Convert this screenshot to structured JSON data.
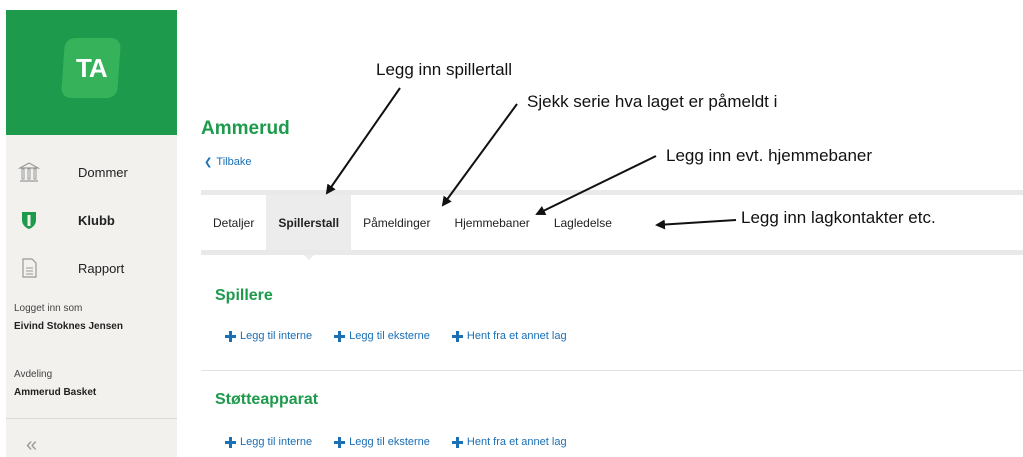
{
  "sidebar": {
    "logo_text": "TA",
    "brand_color": "#1e9a4c",
    "items": [
      {
        "label": "Dommer",
        "icon": "courthouse-icon"
      },
      {
        "label": "Klubb",
        "icon": "shield-icon"
      },
      {
        "label": "Rapport",
        "icon": "document-icon"
      }
    ],
    "logged_in_label": "Logget inn som",
    "logged_in_user": "Eivind Stoknes Jensen",
    "department_label": "Avdeling",
    "department_name": "Ammerud Basket",
    "collapse_icon": "double-chevron-left-icon"
  },
  "main": {
    "title": "Ammerud",
    "back_label": "Tilbake",
    "tabs": [
      {
        "label": "Detaljer"
      },
      {
        "label": "Spillerstall",
        "active": true
      },
      {
        "label": "Påmeldinger"
      },
      {
        "label": "Hjemmebaner"
      },
      {
        "label": "Lagledelse"
      }
    ],
    "sections": [
      {
        "title": "Spillere",
        "actions": [
          "Legg til interne",
          "Legg til eksterne",
          "Hent fra et annet lag"
        ]
      },
      {
        "title": "Støtteapparat",
        "actions": [
          "Legg til interne",
          "Legg til eksterne",
          "Hent fra et annet lag"
        ]
      }
    ],
    "link_color": "#1a6fb5"
  },
  "annotations": {
    "spillertall": "Legg inn spillertall",
    "serie": "Sjekk serie hva laget er påmeldt i",
    "hjemmebaner": "Legg inn evt. hjemmebaner",
    "lagkontakter": "Legg inn lagkontakter etc."
  }
}
